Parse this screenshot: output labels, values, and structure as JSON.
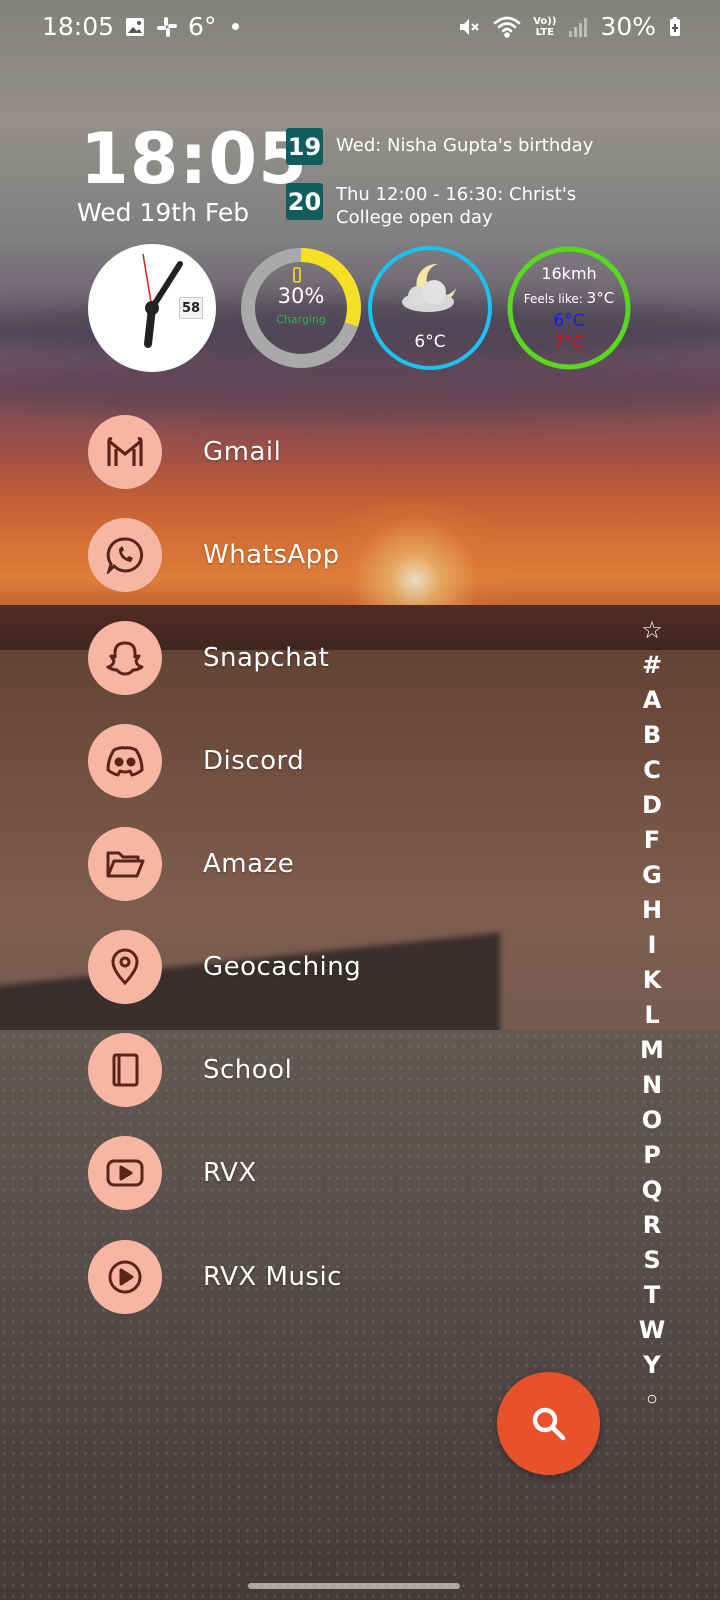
{
  "status_bar": {
    "time": "18:05",
    "temperature": "6°",
    "battery": "30%",
    "icons": [
      "gallery-icon",
      "slack-icon",
      "notification-dot",
      "mute-icon",
      "wifi-icon",
      "volte-icon",
      "signal-icon",
      "battery-saver-icon"
    ],
    "volte_label_top": "Vo))",
    "volte_label_bottom": "LTE"
  },
  "clock_widget": {
    "time": "18:05",
    "date": "Wed 19th Feb"
  },
  "calendar": {
    "events": [
      {
        "day": "19",
        "text": "Wed: Nisha Gupta's birthday"
      },
      {
        "day": "20",
        "text": "Thu 12:00 - 16:30: Christ's College open day"
      }
    ]
  },
  "analog_clock": {
    "seconds": "58"
  },
  "battery_widget": {
    "percent": "30%",
    "level": 0.3,
    "status": "Charging",
    "ring_color": "#f5e027",
    "track_color": "#a9a9a9"
  },
  "weather_widget": {
    "temperature": "6°C",
    "icon": "moon-cloud-icon",
    "ring_color": "#1cc3f0"
  },
  "wind_widget": {
    "speed": "16kmh",
    "feels_like_label": "Feels like:",
    "feels_like_value": "3°C",
    "low": "6°C",
    "high": "7°C",
    "ring_color": "#58d81e",
    "low_color": "#1a1aff",
    "high_color": "#e01010"
  },
  "apps": [
    {
      "label": "Gmail",
      "icon": "gmail-icon"
    },
    {
      "label": "WhatsApp",
      "icon": "whatsapp-icon"
    },
    {
      "label": "Snapchat",
      "icon": "snapchat-icon"
    },
    {
      "label": "Discord",
      "icon": "discord-icon"
    },
    {
      "label": "Amaze",
      "icon": "folder-icon"
    },
    {
      "label": "Geocaching",
      "icon": "location-pin-icon"
    },
    {
      "label": "School",
      "icon": "book-icon"
    },
    {
      "label": "RVX",
      "icon": "youtube-icon"
    },
    {
      "label": "RVX Music",
      "icon": "music-play-icon"
    }
  ],
  "alphabet_index": [
    "☆",
    "#",
    "A",
    "B",
    "C",
    "D",
    "F",
    "G",
    "H",
    "I",
    "K",
    "L",
    "M",
    "N",
    "O",
    "P",
    "Q",
    "R",
    "S",
    "T",
    "W",
    "Y",
    "◦"
  ],
  "search_fab": {
    "icon": "search-icon",
    "color": "#e8522a"
  },
  "colors": {
    "app_circle": "#f7b6a4",
    "app_icon": "#5a2418",
    "calendar_day": "#0f5d5c"
  }
}
